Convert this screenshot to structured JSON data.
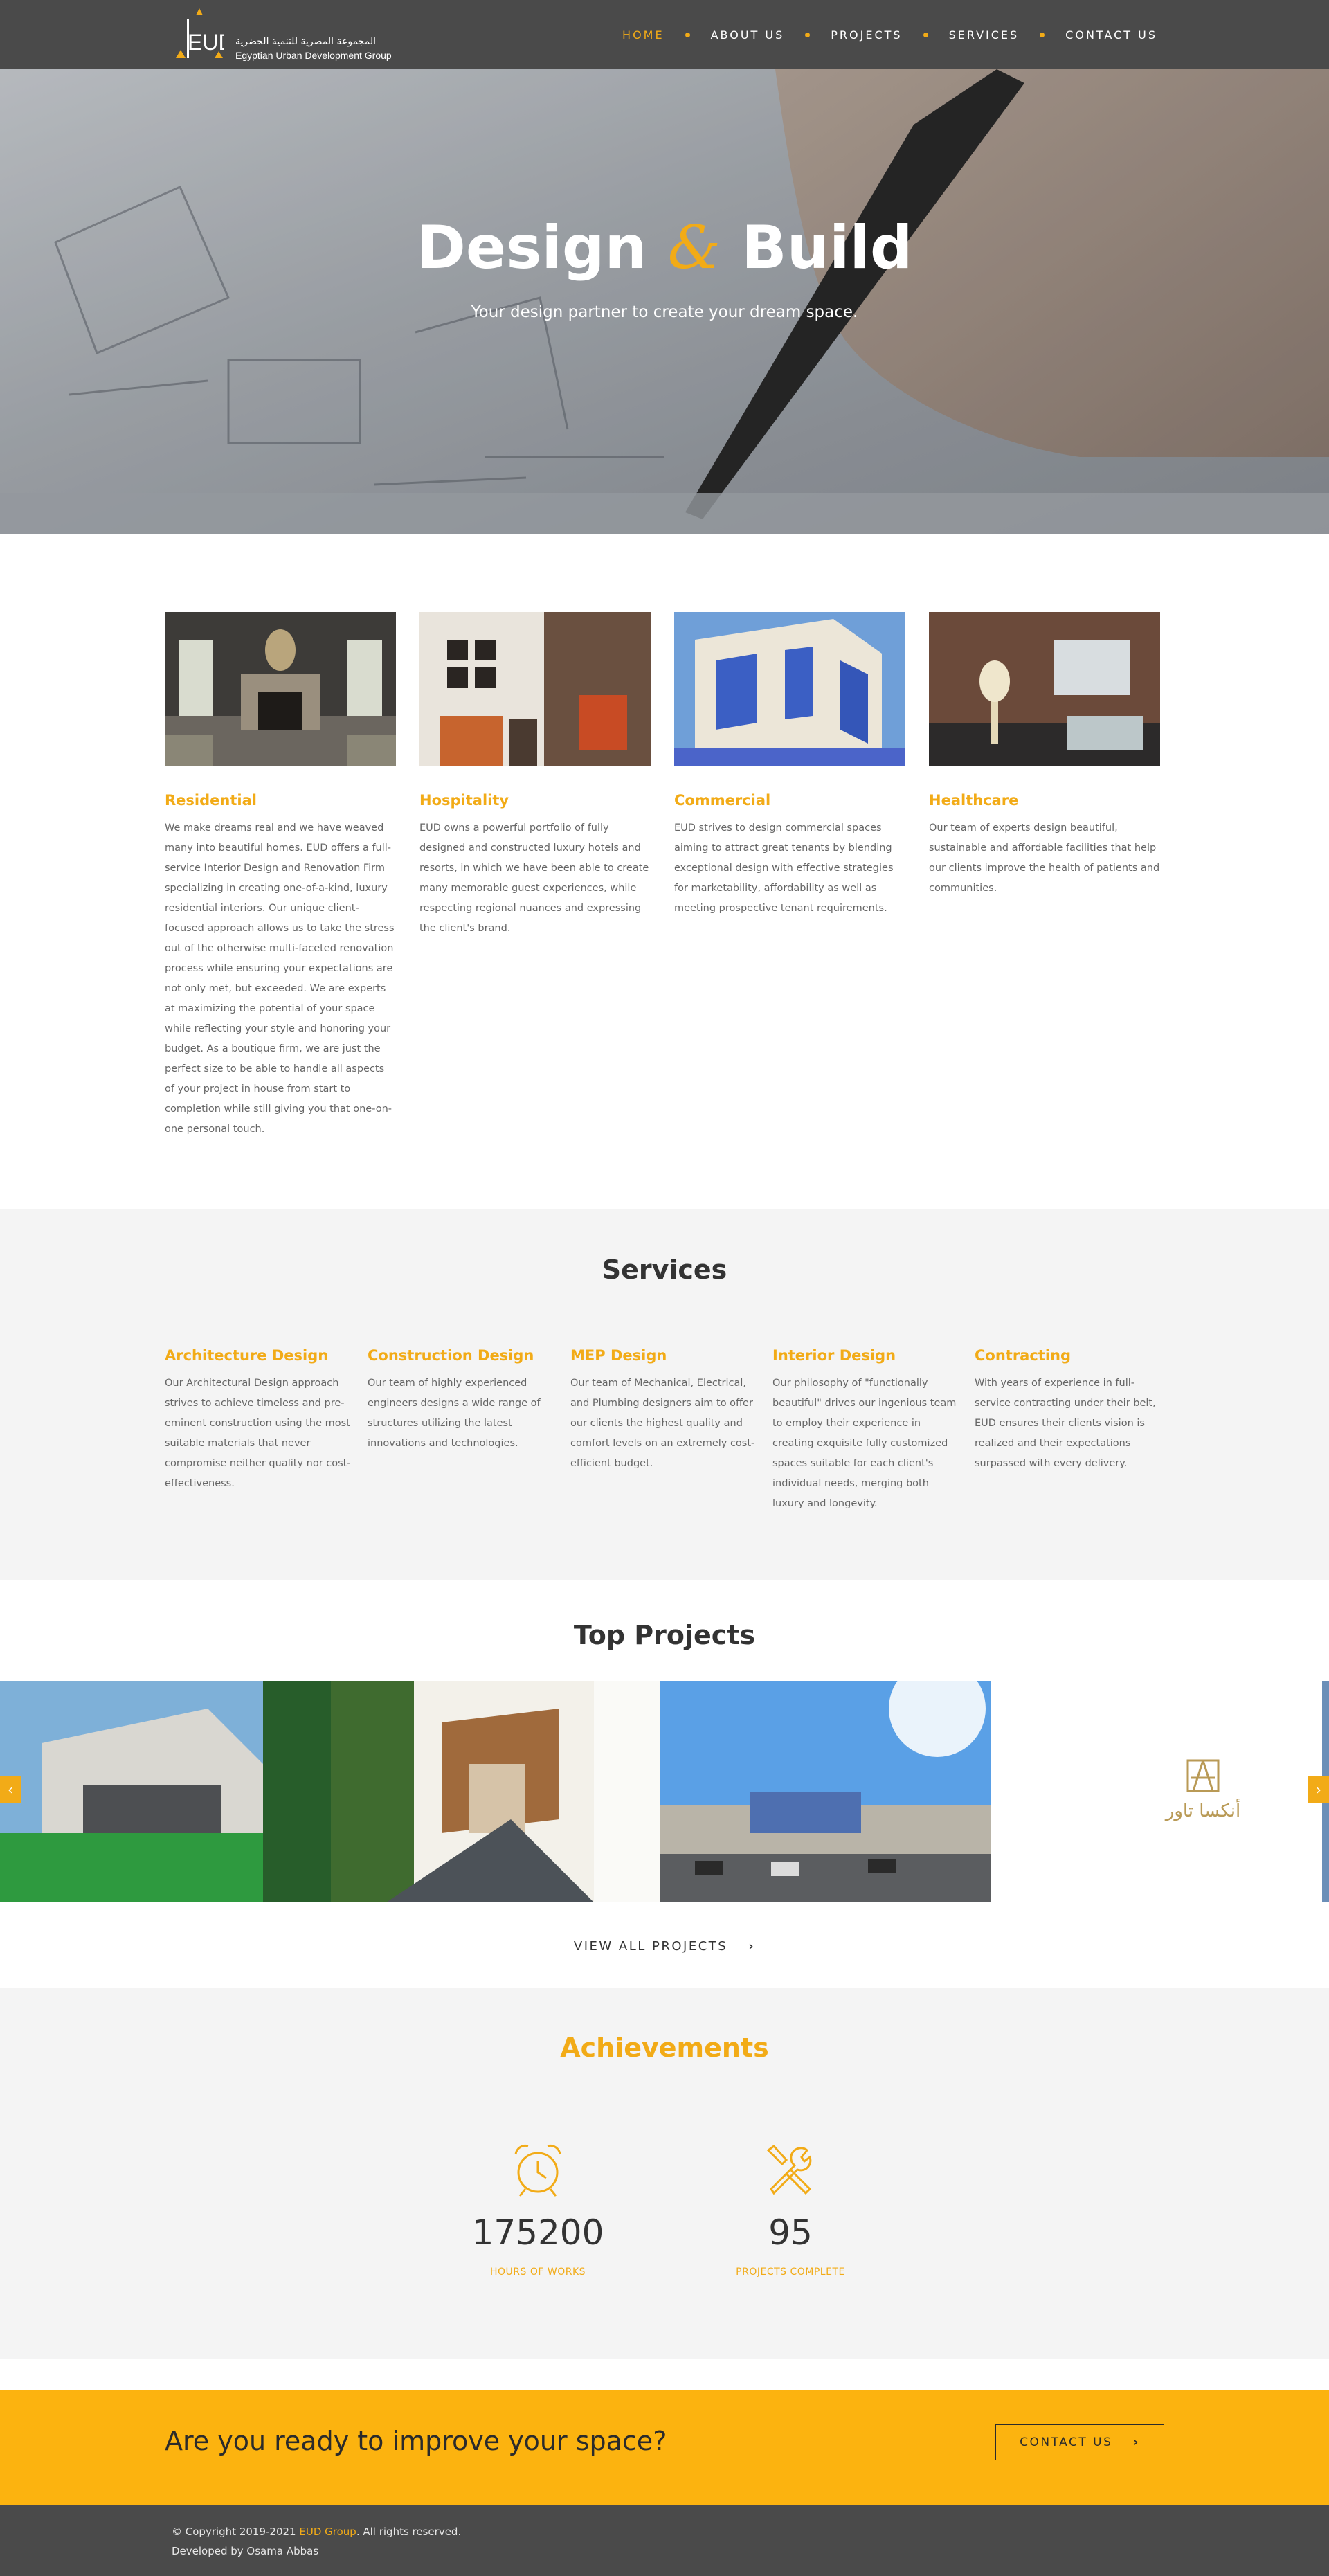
{
  "brand": {
    "logo_text": "EUD",
    "name_ar": "المجموعة المصرية للتنمية الحضرية",
    "name_en": "Egyptian Urban Development Group"
  },
  "nav": {
    "items": [
      {
        "label": "HOME",
        "active": true
      },
      {
        "label": "ABOUT US",
        "active": false
      },
      {
        "label": "PROJECTS",
        "active": false
      },
      {
        "label": "SERVICES",
        "active": false
      },
      {
        "label": "CONTACT US",
        "active": false
      }
    ]
  },
  "hero": {
    "title_part1": "Design",
    "title_amp": "&",
    "title_part2": "Build",
    "subtitle": "Your design partner to create your dream space."
  },
  "categories": [
    {
      "title": "Residential",
      "text": "We make dreams real and we have weaved many into beautiful homes. EUD offers a full-service Interior Design and Renovation Firm specializing in creating one-of-a-kind, luxury residential interiors. Our unique client-focused approach allows us to take the stress out of the otherwise multi-faceted renovation process while ensuring your expectations are not only met, but exceeded. We are experts at maximizing the potential of your space while reflecting your style and honoring your budget. As a boutique firm, we are just the perfect size to be able to handle all aspects of your project in house from start to completion while still giving you that one-on-one personal touch."
    },
    {
      "title": "Hospitality",
      "text": "EUD owns a powerful portfolio of fully designed and constructed luxury hotels and resorts, in which we have been able to create many memorable guest experiences, while respecting regional nuances and expressing the client's brand."
    },
    {
      "title": "Commercial",
      "text": "EUD strives to design commercial spaces aiming to attract great tenants by blending exceptional design with effective strategies for marketability, affordability as well as meeting prospective tenant requirements."
    },
    {
      "title": "Healthcare",
      "text": "Our team of experts design beautiful, sustainable and affordable facilities that help our clients improve the health of patients and communities."
    }
  ],
  "services": {
    "title": "Services",
    "items": [
      {
        "title": "Architecture Design",
        "text": "Our Architectural Design approach strives to achieve timeless and pre-eminent construction using the most suitable materials that never compromise neither quality nor cost-effectiveness."
      },
      {
        "title": "Construction Design",
        "text": "Our team of highly experienced engineers designs a wide range of structures utilizing the latest innovations and technologies."
      },
      {
        "title": "MEP Design",
        "text": "Our team of Mechanical, Electrical, and Plumbing designers aim to offer our clients the highest quality and comfort levels on an extremely cost-efficient budget."
      },
      {
        "title": "Interior Design",
        "text": "Our philosophy of \"functionally beautiful\" drives our ingenious team to employ their experience in creating exquisite fully customized spaces suitable for each client's individual needs, merging both luxury and longevity."
      },
      {
        "title": "Contracting",
        "text": "With years of experience in full-service contracting under their belt, EUD ensures their clients vision is realized and their expectations surpassed with every delivery."
      }
    ]
  },
  "projects": {
    "title": "Top Projects",
    "slide_logo_text": "أنكسا تاور",
    "prev_icon": "‹",
    "next_icon": "›",
    "view_all_label": "VIEW ALL PROJECTS",
    "chevron": "›"
  },
  "achievements": {
    "title": "Achievements",
    "stats": [
      {
        "number": "175200",
        "label": "HOURS OF WORKS",
        "icon": "alarm-clock-icon"
      },
      {
        "number": "95",
        "label": "PROJECTS COMPLETE",
        "icon": "wrench-screwdriver-icon"
      }
    ]
  },
  "cta": {
    "text": "Are you ready to improve your space?",
    "button_label": "CONTACT US",
    "chevron": "›"
  },
  "footer": {
    "copyright_prefix": "© Copyright 2019-2021 ",
    "brand": "EUD Group",
    "copyright_suffix": ". All rights reserved.",
    "developer": "Developed by Osama Abbas"
  },
  "colors": {
    "accent": "#f2ab17",
    "cta_bg": "#fcb30f",
    "dark_bar": "#4a4a4a",
    "section_bg": "#f4f4f4"
  }
}
